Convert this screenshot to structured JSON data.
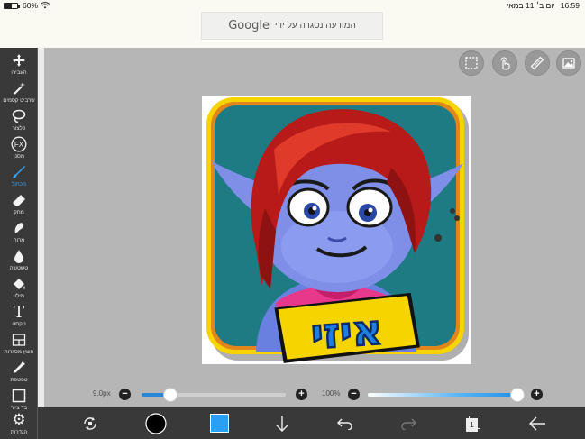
{
  "status_bar": {
    "battery_percent": "60%",
    "time": "16:59",
    "date": "יום ב׳ 11 במאי",
    "battery_level": 0.6
  },
  "ad": {
    "text": "המודעה נסגרה על ידי",
    "brand": "Google"
  },
  "tools": [
    {
      "id": "move",
      "icon": "move-icon",
      "label": "העבירו"
    },
    {
      "id": "magic-wand",
      "icon": "magic-wand-icon",
      "label": "שרביט קסמים"
    },
    {
      "id": "lasso",
      "icon": "lasso-icon",
      "label": "פלצור"
    },
    {
      "id": "filter",
      "icon": "fx-icon",
      "label": "מסנן"
    },
    {
      "id": "brush",
      "icon": "brush-icon",
      "label": "מכחול",
      "active": true
    },
    {
      "id": "eraser",
      "icon": "eraser-icon",
      "label": "מחק"
    },
    {
      "id": "smudge",
      "icon": "smudge-icon",
      "label": "מרוח"
    },
    {
      "id": "blur",
      "icon": "blur-drop-icon",
      "label": "טשטשה"
    },
    {
      "id": "fill",
      "icon": "bucket-icon",
      "label": "מילוי"
    },
    {
      "id": "text",
      "icon": "text-icon",
      "label": "טקסט"
    },
    {
      "id": "frame-divider",
      "icon": "frame-divider-icon",
      "label": "חוצץ מסגרות"
    },
    {
      "id": "dropper",
      "icon": "eyedropper-icon",
      "label": "טפטפת"
    },
    {
      "id": "canvas",
      "icon": "canvas-icon",
      "label": "בד ציור"
    },
    {
      "id": "settings",
      "icon": "gear-icon",
      "label": "הגדרות"
    }
  ],
  "top_right_buttons": [
    "selection-icon",
    "touch-icon",
    "ruler-pencil-icon",
    "image-icon"
  ],
  "brush_size": {
    "label": "9.0px",
    "value_fraction": 0.2
  },
  "opacity": {
    "label": "100%",
    "value_fraction": 1.0
  },
  "bottom_bar": [
    "transform-icon",
    "brush-preview-icon",
    "color-swatch",
    "download-icon",
    "undo-icon",
    "redo-icon",
    "layers-icon",
    "back-arrow-icon"
  ],
  "layers_count": "1",
  "colors": {
    "accent": "#3aa2f2",
    "swatch": "#2aa0f5",
    "toolbar": "#393939",
    "workspace": "#b6b6b6"
  },
  "artwork": {
    "badge_text": "איזי"
  }
}
